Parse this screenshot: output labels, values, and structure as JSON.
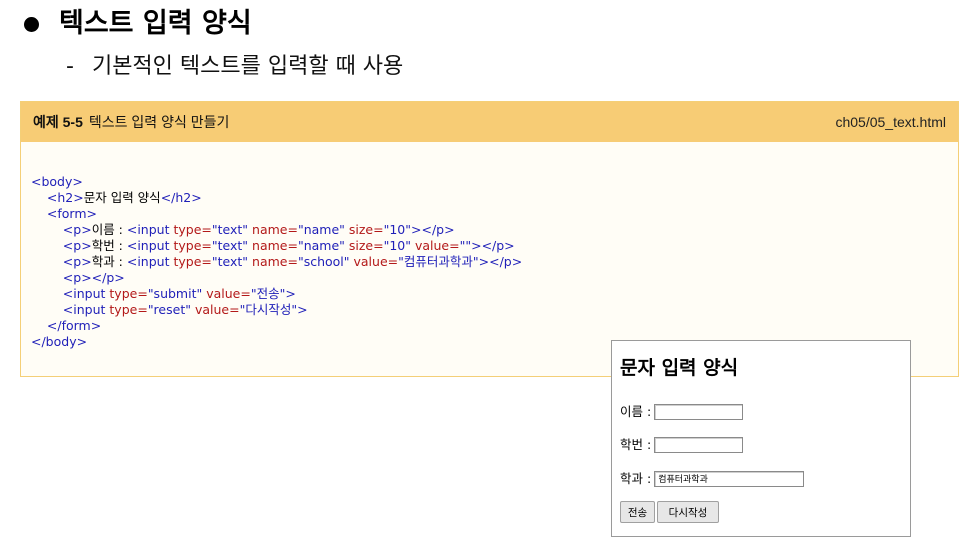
{
  "heading": {
    "title": "텍스트 입력 양식"
  },
  "subheading": {
    "dash": "-",
    "text": "기본적인 텍스트를 입력할 때 사용"
  },
  "example": {
    "number": "예제 5-5",
    "caption": "텍스트 입력 양식 만들기",
    "filename": "ch05/05_text.html"
  },
  "code": {
    "body_open": "<body>",
    "h2": [
      "<h2>",
      "문자 입력 양식",
      "</h2>"
    ],
    "form_open": "<form>",
    "line_name": {
      "p_open": "<p>",
      "label": "이름 : ",
      "input_open": "<input ",
      "a1": "type=",
      "v1": "\"text\"",
      "a2": " name=",
      "v2": "\"name\"",
      "a3": " size=",
      "v3": "\"10\"",
      "close": "></p>"
    },
    "line_hakbun": {
      "p_open": "<p>",
      "label": "학번 : ",
      "input_open": "<input ",
      "a1": "type=",
      "v1": "\"text\"",
      "a2": " name=",
      "v2": "\"name\"",
      "a3": " size=",
      "v3": "\"10\"",
      "a4": " value=",
      "v4": "\"\"",
      "close": "></p>"
    },
    "line_school": {
      "p_open": "<p>",
      "label": "학과 : ",
      "input_open": "<input ",
      "a1": "type=",
      "v1": "\"text\"",
      "a2": " name=",
      "v2": "\"school\"",
      "a3": " value=",
      "v3": "\"컴퓨터과학과\"",
      "close": "></p>"
    },
    "empty_p": "<p></p>",
    "submit": {
      "open": "<input ",
      "a1": "type=",
      "v1": "\"submit\"",
      "a2": " value=",
      "v2": "\"전송\"",
      "close": ">"
    },
    "reset": {
      "open": "<input ",
      "a1": "type=",
      "v1": "\"reset\"",
      "a2": " value=",
      "v2": "\"다시작성\"",
      "close": ">"
    },
    "form_close": "</form>",
    "body_close": "</body>"
  },
  "preview": {
    "title": "문자 입력 양식",
    "name_label": "이름 :",
    "name_value": "",
    "hakbun_label": "학번 :",
    "hakbun_value": "",
    "school_label": "학과 :",
    "school_value": "컴퓨터과학과",
    "submit_label": "전송",
    "reset_label": "다시작성"
  }
}
